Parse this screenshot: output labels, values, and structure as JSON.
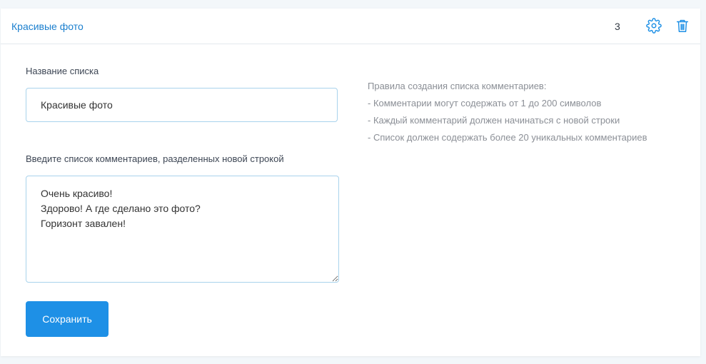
{
  "header": {
    "title": "Красивые фото",
    "count": "3",
    "settings_icon": "gear-icon",
    "delete_icon": "trash-icon"
  },
  "form": {
    "name_label": "Название списка",
    "name_value": "Красивые фото",
    "comments_label": "Введите список комментариев, разделенных новой строкой",
    "comments_value": "Очень красиво!\nЗдорово! А где сделано это фото?\nГоризонт завален!",
    "save_label": "Сохранить"
  },
  "rules": {
    "title": "Правила создания списка комментариев:",
    "items": [
      "- Комментарии могут содержать от 1 до 200 символов",
      "- Каждый комментарий должен начинаться с новой строки",
      "- Список должен содержать более 20 уникальных комментариев"
    ]
  },
  "colors": {
    "accent": "#1e90e6",
    "link": "#1b7fce",
    "input_border": "#a9d3ec"
  }
}
